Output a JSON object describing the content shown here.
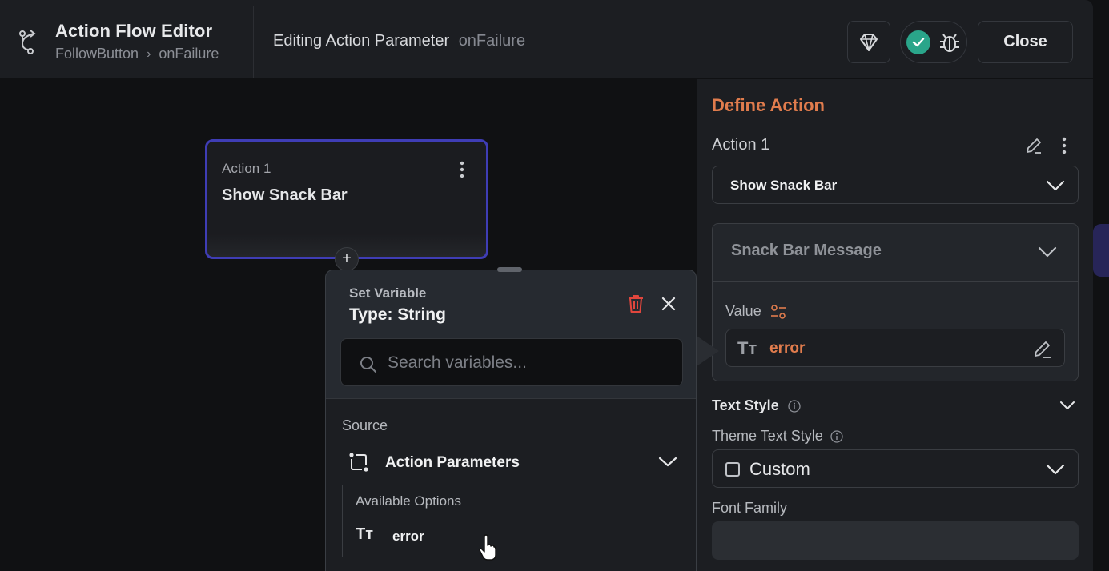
{
  "header": {
    "app_title": "Action Flow Editor",
    "breadcrumb": [
      "FollowButton",
      "onFailure"
    ],
    "editing_label": "Editing Action Parameter",
    "editing_param": "onFailure",
    "close_label": "Close"
  },
  "canvas": {
    "node": {
      "label": "Action 1",
      "name": "Show Snack Bar"
    },
    "add_label": "+"
  },
  "popover": {
    "title": "Set Variable",
    "type": "Type: String",
    "search_placeholder": "Search variables...",
    "source_label": "Source",
    "source_name": "Action Parameters",
    "options_label": "Available Options",
    "options": [
      {
        "icon": "text-type-icon",
        "glyph": "Tт",
        "name": "error"
      }
    ]
  },
  "panel": {
    "title": "Define Action",
    "action_name": "Action 1",
    "action_type": "Show Snack Bar",
    "snack_bar_title": "Snack Bar Message",
    "value_label": "Value",
    "value_glyph": "Tт",
    "value_text": "error",
    "text_style_label": "Text Style",
    "theme_text_style_label": "Theme Text Style",
    "theme_text_style_value": "Custom",
    "font_family_label": "Font Family"
  },
  "colors": {
    "accent_orange": "#e07c4d",
    "node_border": "#3f3db5",
    "status_green": "#2aa58a",
    "delete_red": "#e0463d"
  }
}
